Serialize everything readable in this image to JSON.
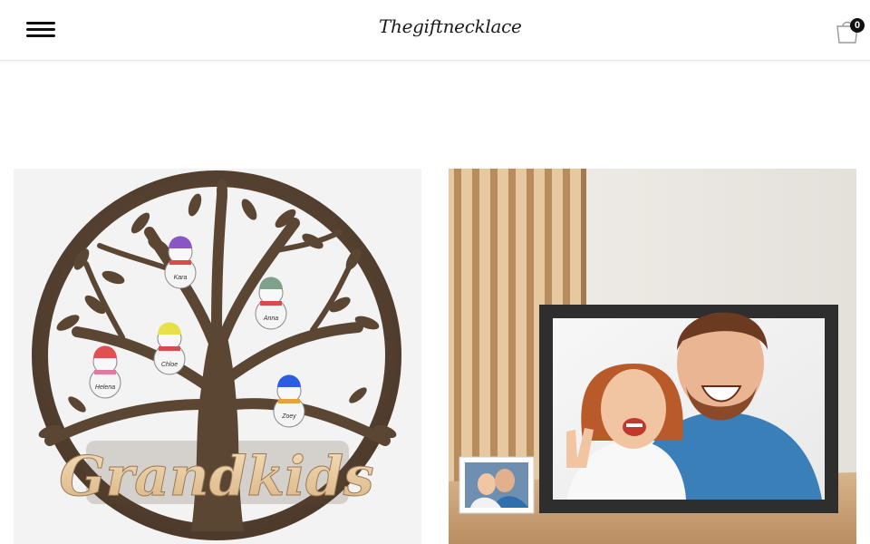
{
  "header": {
    "logo_text": "Thegiftnecklace",
    "menu_icon": "hamburger-menu-icon",
    "cart_icon": "shopping-bag-icon",
    "cart_count": "0"
  },
  "products": [
    {
      "image_icon": "grandkids-family-tree-sign-image",
      "sign_text": "Grandkids",
      "ornament_names": [
        "Kara",
        "Anna",
        "Chloe",
        "Helena",
        "Zoey"
      ]
    },
    {
      "image_icon": "couple-photo-frame-image"
    }
  ],
  "colors": {
    "header_bg": "#ffffff",
    "text_primary": "#111111",
    "wood_dark": "#5b4634",
    "wood_light": "#e6c9a0"
  }
}
